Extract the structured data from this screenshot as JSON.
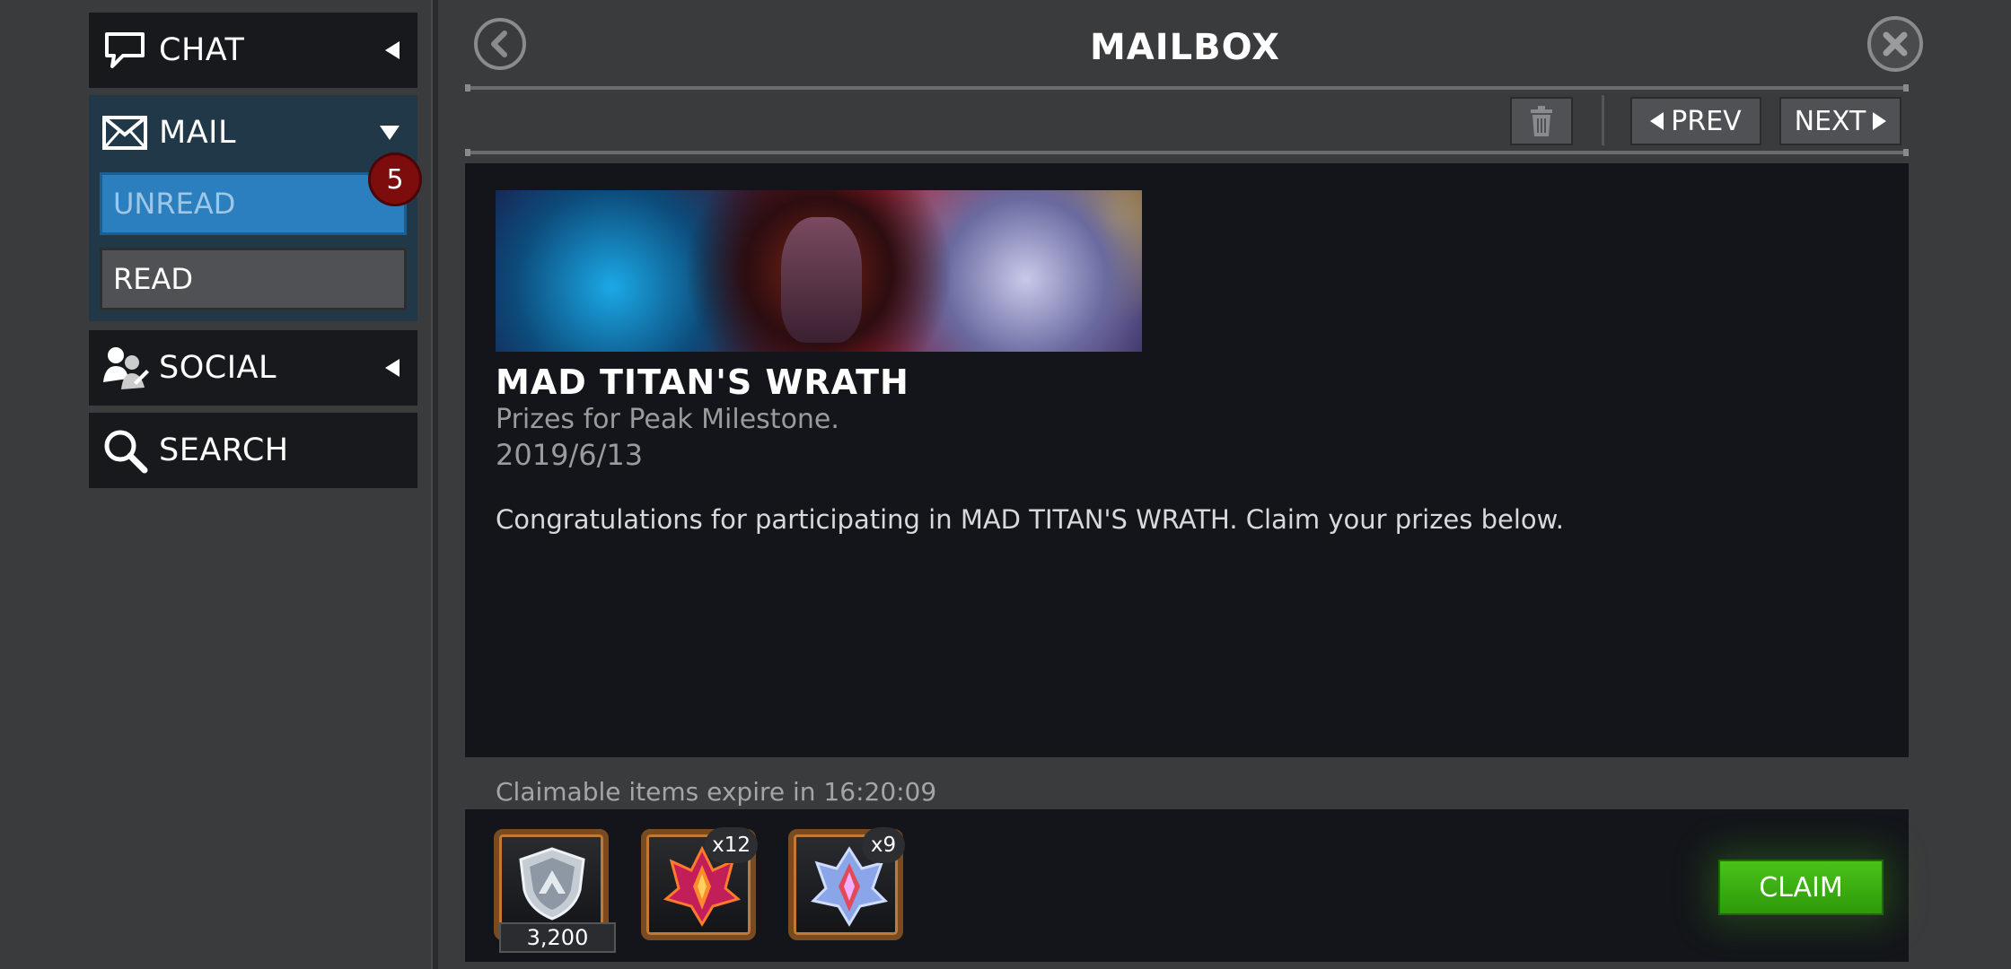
{
  "sidebar": {
    "chat_label": "CHAT",
    "mail_label": "MAIL",
    "unread_label": "UNREAD",
    "read_label": "READ",
    "unread_count": "5",
    "social_label": "SOCIAL",
    "search_label": "SEARCH"
  },
  "header": {
    "title": "MAILBOX",
    "prev_label": "PREV",
    "next_label": "NEXT"
  },
  "message": {
    "title": "MAD TITAN'S WRATH",
    "subtitle": "Prizes for Peak Milestone.",
    "date": "2019/6/13",
    "body": "Congratulations for participating in MAD TITAN'S WRATH. Claim your prizes below."
  },
  "rewards": {
    "expire_text": "Claimable items expire in 16:20:09",
    "items": [
      {
        "icon": "alliance-shield-icon",
        "quantity": "3,200"
      },
      {
        "icon": "red-crystal-icon",
        "count": "x12"
      },
      {
        "icon": "blue-crystal-icon",
        "count": "x9"
      }
    ],
    "claim_label": "CLAIM"
  },
  "colors": {
    "accent_blue": "#2b7fbe",
    "claim_green": "#3aae12",
    "badge_red": "#7d0d0d"
  }
}
